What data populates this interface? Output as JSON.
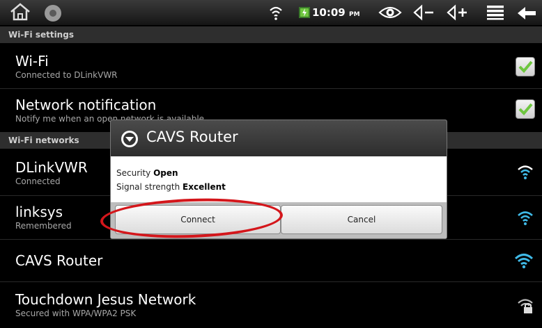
{
  "statusbar": {
    "time": "10:09",
    "ampm": "PM"
  },
  "sections": {
    "settings": "Wi-Fi settings",
    "networks": "Wi-Fi networks"
  },
  "wifi_row": {
    "title": "Wi-Fi",
    "subtitle": "Connected to DLinkVWR"
  },
  "notif_row": {
    "title": "Network notification",
    "subtitle": "Notify me when an open network is available"
  },
  "networks": [
    {
      "name": "DLinkVWR",
      "status": "Connected"
    },
    {
      "name": "linksys",
      "status": "Remembered"
    },
    {
      "name": "CAVS Router",
      "status": ""
    },
    {
      "name": "Touchdown Jesus Network",
      "status": "Secured with WPA/WPA2 PSK"
    }
  ],
  "dialog": {
    "title": "CAVS Router",
    "security_label": "Security",
    "security_value": "Open",
    "signal_label": "Signal strength",
    "signal_value": "Excellent",
    "connect": "Connect",
    "cancel": "Cancel"
  },
  "colors": {
    "accent": "#3fb9e6",
    "check": "#6ec63f",
    "highlight": "#d4161b"
  }
}
